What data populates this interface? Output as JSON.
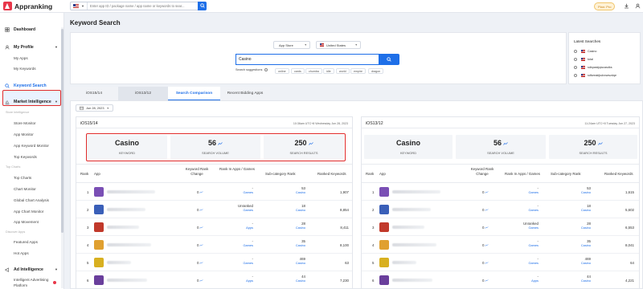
{
  "app": {
    "name": "Appranking"
  },
  "topbar": {
    "search_placeholder": "Enter app ID / package name / app name or keywords to sear...",
    "plan_label": "Plan: Pro"
  },
  "sidebar": {
    "dashboard": "Dashboard",
    "my_profile": "My Profile",
    "my_apps": "My Apps",
    "my_keywords": "My Keywords",
    "keyword_search": "Keyword Search",
    "market_intelligence": "Market Intelligence",
    "store_intelligence": "Store Intelligence",
    "store_monitor": "Store Monitor",
    "app_monitor": "App Monitor",
    "app_keyword_monitor": "App Keyword Monitor",
    "top_keywords": "Top Keywords",
    "top_charts_section": "Top Charts",
    "top_charts": "Top Charts",
    "chart_monitor": "Chart Monitor",
    "global_chart_analysis": "Global Chart Analysis",
    "app_chart_monitor": "App Chart Monitor",
    "app_movement": "App Movement",
    "discover_apps": "Discover Apps",
    "featured_apps": "Featured Apps",
    "hot_apps": "Hot Apps",
    "ad_intelligence": "Ad Intelligence",
    "intelligent_advertising": "Intelligent Advertising",
    "platform": "Platform"
  },
  "page": {
    "title": "Keyword Search"
  },
  "search": {
    "store": "App Store",
    "country": "United States",
    "keyword": "Casino",
    "suggestions_label": "Search suggestions",
    "suggestions": [
      "online",
      "cards",
      "chumba",
      "idle",
      "world",
      "empire",
      "dragon"
    ]
  },
  "latest": {
    "title": "Latest Searches",
    "items": [
      "Casino",
      "total",
      "sdkpaskjqwcasdks",
      "sdfweakijsdxxwwzdqe"
    ]
  },
  "tabs": [
    "iOS15/14",
    "iOS13/12",
    "Search Comparison",
    "Recent Bidding Apps"
  ],
  "date_filter": "Jun 28, 2023",
  "panels": [
    {
      "title": "iOS15/14",
      "date": "10:36am UTC+8 Wednesday Jun 28, 2023",
      "keyword": "Casino",
      "keyword_label": "KEYWORD",
      "volume": "56",
      "volume_label": "SEARCH VOLUME",
      "results": "250",
      "results_label": "SEARCH RESULTS",
      "headers": {
        "rank": "Rank",
        "app": "App",
        "kw_change": "Keyword Rank Change",
        "rank_in": "Rank In Apps / Games",
        "subcat": "Sub-category Rank",
        "ranked": "Ranked Keywords"
      },
      "rows": [
        {
          "rank": "1",
          "change": "0",
          "in_main": "-",
          "in_sub": "Games",
          "sc_main": "53",
          "sc_sub": "Casino",
          "kw": "1,907"
        },
        {
          "rank": "2",
          "change": "0",
          "in_main": "Unranked",
          "in_sub": "Games",
          "sc_main": "18",
          "sc_sub": "Casino",
          "kw": "8,854"
        },
        {
          "rank": "3",
          "change": "0",
          "in_main": "-",
          "in_sub": "Apps",
          "sc_main": "28",
          "sc_sub": "Casino",
          "kw": "8,411"
        },
        {
          "rank": "4",
          "change": "0",
          "in_main": "-",
          "in_sub": "Games",
          "sc_main": "35",
          "sc_sub": "Casino",
          "kw": "8,100"
        },
        {
          "rank": "5",
          "change": "0",
          "in_main": "-",
          "in_sub": "Games",
          "sc_main": "469",
          "sc_sub": "Casino",
          "kw": "63"
        },
        {
          "rank": "6",
          "change": "0",
          "in_main": "-",
          "in_sub": "Apps",
          "sc_main": "44",
          "sc_sub": "Casino",
          "kw": "7,230"
        }
      ]
    },
    {
      "title": "iOS13/12",
      "date": "11:24am UTC+8 Tuesday Jun 27, 2023",
      "keyword": "Casino",
      "keyword_label": "KEYWORD",
      "volume": "56",
      "volume_label": "SEARCH VOLUME",
      "results": "250",
      "results_label": "SEARCH RESULTS",
      "headers": {
        "rank": "Rank",
        "app": "App",
        "kw_change": "Keyword Rank Change",
        "rank_in": "Rank In Apps / Games",
        "subcat": "Sub-category Rank",
        "ranked": "Ranked Keywords"
      },
      "rows": [
        {
          "rank": "1",
          "change": "0",
          "in_main": "-",
          "in_sub": "Games",
          "sc_main": "53",
          "sc_sub": "Casino",
          "kw": "1,615"
        },
        {
          "rank": "2",
          "change": "0",
          "in_main": "-",
          "in_sub": "Games",
          "sc_main": "18",
          "sc_sub": "Casino",
          "kw": "5,602"
        },
        {
          "rank": "3",
          "change": "0",
          "in_main": "Unranked",
          "in_sub": "Games",
          "sc_main": "28",
          "sc_sub": "Casino",
          "kw": "6,553"
        },
        {
          "rank": "4",
          "change": "0",
          "in_main": "-",
          "in_sub": "Games",
          "sc_main": "35",
          "sc_sub": "Casino",
          "kw": "8,041"
        },
        {
          "rank": "5",
          "change": "0",
          "in_main": "-",
          "in_sub": "Games",
          "sc_main": "469",
          "sc_sub": "Casino",
          "kw": "64"
        },
        {
          "rank": "6",
          "change": "0",
          "in_main": "-",
          "in_sub": "Apps",
          "sc_main": "44",
          "sc_sub": "Casino",
          "kw": "4,221"
        }
      ]
    }
  ],
  "colors": {
    "accent": "#1e6fe8",
    "highlight": "#e02b2b",
    "brand": "#e8374a"
  }
}
